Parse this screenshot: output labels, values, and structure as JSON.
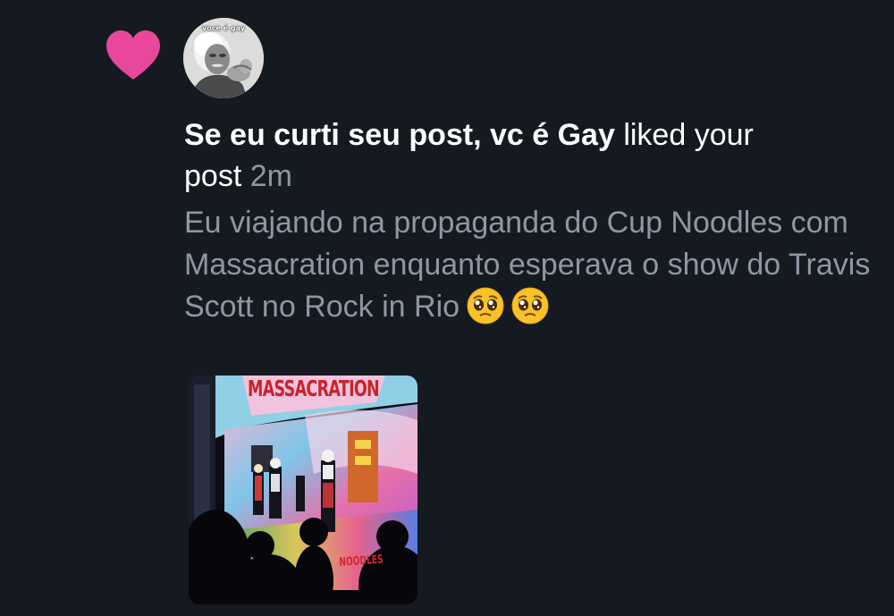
{
  "notification": {
    "type": "like",
    "icon": "heart-icon",
    "heart_color": "#e8479b",
    "avatar": {
      "icon": "portrait-photo",
      "caption": "voce é gay"
    },
    "actor_name": "Se eu curti seu post, vc é Gay",
    "action_text_1": " liked your",
    "action_text_2": "post",
    "time": "2m",
    "post_text": "Eu viajando na propaganda do Cup Noodles com Massacration enquanto esperava o show  do Travis Scott no Rock in Rio",
    "post_emojis": [
      "pleading-face-icon",
      "pleading-face-icon"
    ],
    "media": {
      "icon": "concert-stage-photo",
      "banner_text": "MASSACRATION",
      "floor_text": "NOODLES"
    }
  },
  "colors": {
    "background": "#151a21",
    "primary_text": "#ffffff",
    "secondary_text": "#8b98a5",
    "heart": "#e8479b"
  }
}
